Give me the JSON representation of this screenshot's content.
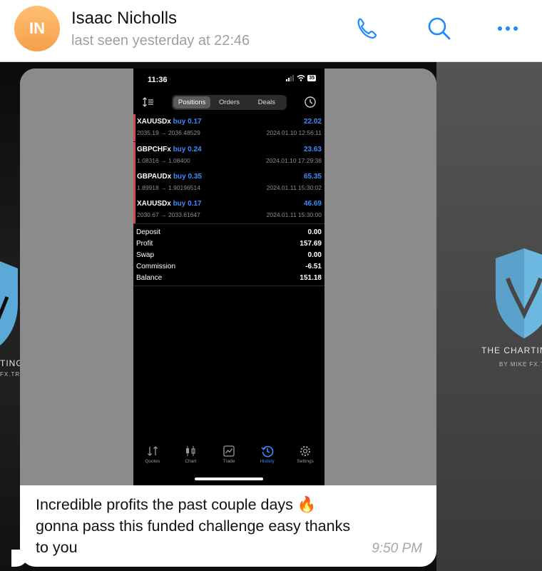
{
  "header": {
    "avatar_initials": "IN",
    "contact_name": "Isaac Nicholls",
    "last_seen": "last seen yesterday at 22:46",
    "icons": [
      "phone-icon",
      "search-icon",
      "more-icon"
    ],
    "accent_color": "#1a8cff"
  },
  "wallpaper": {
    "left_logo_text": "TING",
    "left_logo_sub": "FX.TRA",
    "right_logo_text": "THE CHARTING",
    "right_logo_sub": "BY MIKE FX.TR"
  },
  "phone": {
    "time": "11:36",
    "battery": "35",
    "tabs": [
      "Positions",
      "Orders",
      "Deals"
    ],
    "active_tab": "Positions",
    "positions": [
      {
        "symbol": "XAUUSDx",
        "direction": "buy 0.17",
        "profit": "22.02",
        "prices": "2035.19 → 2036.48529",
        "datetime": "2024.01.10 12:56:11"
      },
      {
        "symbol": "GBPCHFx",
        "direction": "buy 0.24",
        "profit": "23.63",
        "prices": "1.08316 → 1.08400",
        "datetime": "2024.01.10 17:29:38"
      },
      {
        "symbol": "GBPAUDx",
        "direction": "buy 0.35",
        "profit": "65.35",
        "prices": "1.89918 → 1.90196514",
        "datetime": "2024.01.11 15:30:02"
      },
      {
        "symbol": "XAUUSDx",
        "direction": "buy 0.17",
        "profit": "46.69",
        "prices": "2030.67 → 2033.61647",
        "datetime": "2024.01.11 15:30:00"
      }
    ],
    "summary": [
      {
        "label": "Deposit",
        "value": "0.00"
      },
      {
        "label": "Profit",
        "value": "157.69"
      },
      {
        "label": "Swap",
        "value": "0.00"
      },
      {
        "label": "Commission",
        "value": "-6.51"
      },
      {
        "label": "Balance",
        "value": "151.18"
      }
    ],
    "bottom_tabs": [
      {
        "label": "Quotes",
        "icon": "quotes-icon"
      },
      {
        "label": "Chart",
        "icon": "chart-icon"
      },
      {
        "label": "Trade",
        "icon": "trade-icon"
      },
      {
        "label": "History",
        "icon": "history-icon"
      },
      {
        "label": "Settings",
        "icon": "settings-icon"
      }
    ],
    "active_bottom_tab": "History"
  },
  "message": {
    "line1": "Incredible profits the past couple days 🔥",
    "line2": "gonna pass this funded challenge easy thanks",
    "line3": "to you",
    "time": "9:50 PM"
  }
}
